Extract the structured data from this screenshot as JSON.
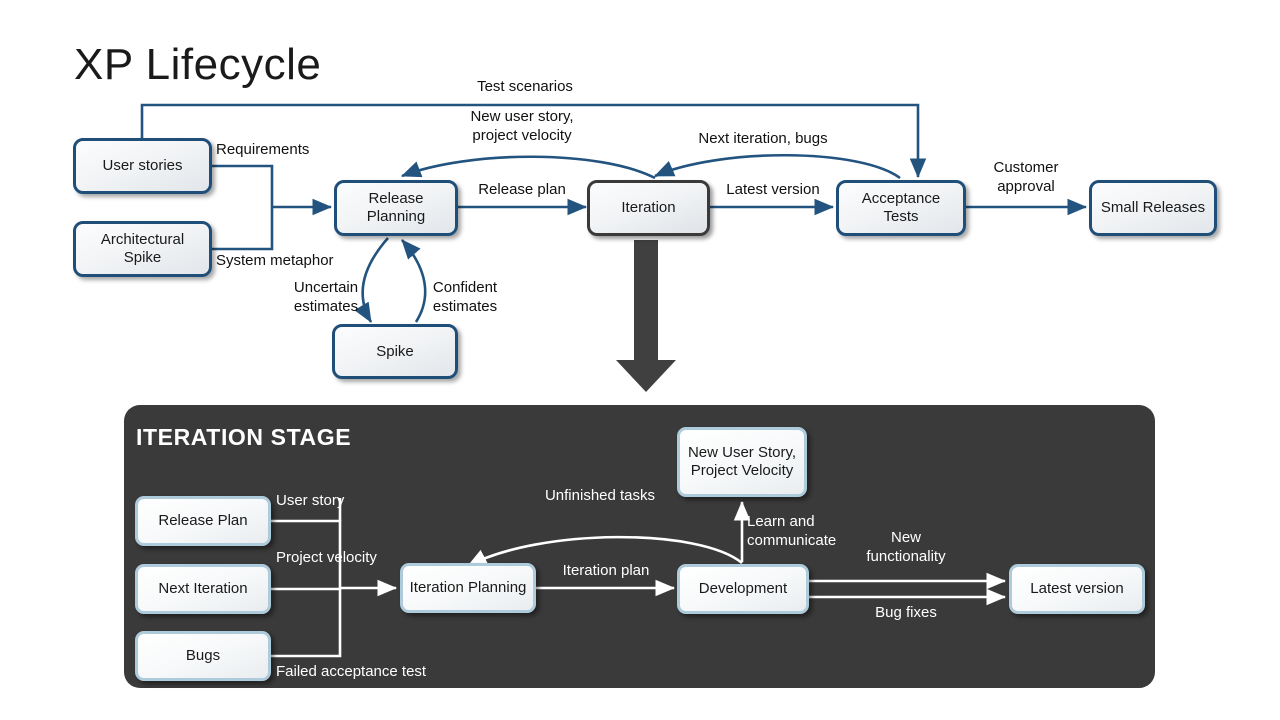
{
  "title": "XP Lifecycle",
  "top_flow": {
    "nodes": [
      {
        "id": "user-stories",
        "label": "User stories"
      },
      {
        "id": "architectural-spike",
        "label": "Architectural\nSpike"
      },
      {
        "id": "release-planning",
        "label": "Release\nPlanning"
      },
      {
        "id": "iteration",
        "label": "Iteration"
      },
      {
        "id": "acceptance-tests",
        "label": "Acceptance\nTests"
      },
      {
        "id": "small-releases",
        "label": "Small\nReleases"
      },
      {
        "id": "spike",
        "label": "Spike"
      }
    ],
    "edge_labels": [
      {
        "id": "requirements",
        "text": "Requirements"
      },
      {
        "id": "system-metaphor",
        "text": "System  metaphor"
      },
      {
        "id": "test-scenarios",
        "text": "Test  scenarios"
      },
      {
        "id": "new-user-story",
        "text": "New  user story,\nproject velocity"
      },
      {
        "id": "next-iteration-bugs",
        "text": "Next  iteration,  bugs"
      },
      {
        "id": "release-plan",
        "text": "Release  plan"
      },
      {
        "id": "latest-version",
        "text": "Latest  version"
      },
      {
        "id": "customer-approval",
        "text": "Customer\napproval"
      },
      {
        "id": "uncertain-estimates",
        "text": "Uncertain\nestimates"
      },
      {
        "id": "confident-estimates",
        "text": "Confident\nestimates"
      }
    ]
  },
  "iteration_stage": {
    "heading": "ITERATION  STAGE",
    "nodes": [
      {
        "id": "release-plan-box",
        "label": "Release  Plan"
      },
      {
        "id": "next-iteration-box",
        "label": "Next  Iteration"
      },
      {
        "id": "bugs-box",
        "label": "Bugs"
      },
      {
        "id": "iteration-planning",
        "label": "Iteration\nPlanning"
      },
      {
        "id": "development",
        "label": "Development"
      },
      {
        "id": "new-user-story-box",
        "label": "New  User\nStory, Project\nVelocity"
      },
      {
        "id": "latest-version-box",
        "label": "Latest  version"
      }
    ],
    "edge_labels": [
      {
        "id": "user-story",
        "text": "User story"
      },
      {
        "id": "project-velocity",
        "text": "Project velocity"
      },
      {
        "id": "failed-acceptance-test",
        "text": "Failed  acceptance  test"
      },
      {
        "id": "iteration-plan",
        "text": "Iteration  plan"
      },
      {
        "id": "unfinished-tasks",
        "text": "Unfinished  tasks"
      },
      {
        "id": "learn-and-communicate",
        "text": "Learn  and\ncommunicate"
      },
      {
        "id": "new-functionality",
        "text": "New\nfunctionality"
      },
      {
        "id": "bug-fixes",
        "text": "Bug fixes"
      }
    ]
  },
  "colors": {
    "blue_border": "#1F4E79",
    "dark_border": "#3a3a3a",
    "panel_bg": "#3a3a3a",
    "light_border": "#aecbdc",
    "arrow_blue": "#22547F",
    "arrow_white": "#ffffff",
    "big_arrow": "#404040"
  }
}
